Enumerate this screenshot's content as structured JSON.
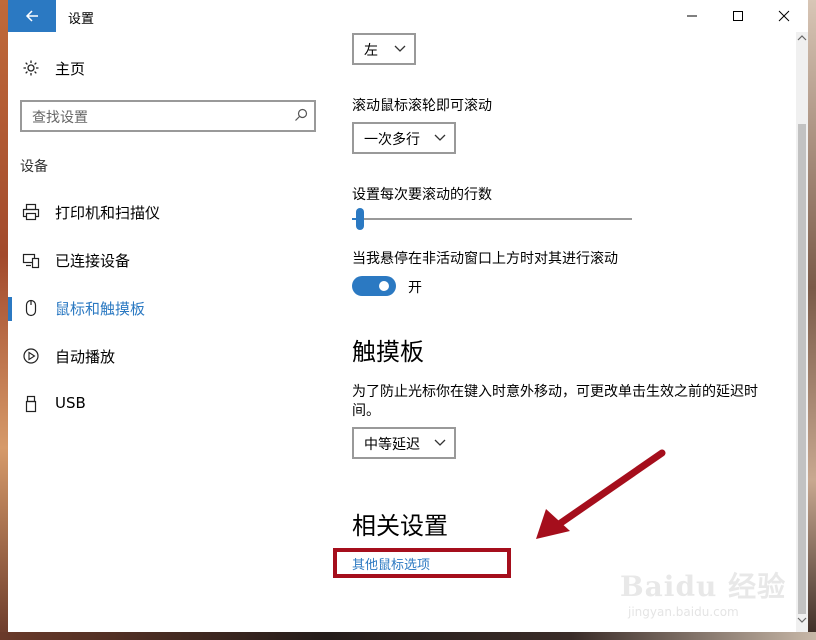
{
  "window": {
    "title": "设置",
    "back_icon": "back-arrow-icon",
    "accent_color": "#2b79c2"
  },
  "sidebar": {
    "home_label": "主页",
    "search_placeholder": "查找设置",
    "section_title": "设备",
    "items": [
      {
        "label": "打印机和扫描仪",
        "icon": "printer-icon",
        "active": false
      },
      {
        "label": "已连接设备",
        "icon": "devices-icon",
        "active": false
      },
      {
        "label": "鼠标和触摸板",
        "icon": "mouse-icon",
        "active": true
      },
      {
        "label": "自动播放",
        "icon": "autoplay-icon",
        "active": false
      },
      {
        "label": "USB",
        "icon": "usb-icon",
        "active": false
      }
    ]
  },
  "mouse": {
    "primary_button_value": "左",
    "wheel_label": "滚动鼠标滚轮即可滚动",
    "wheel_value": "一次多行",
    "lines_label": "设置每次要滚动的行数",
    "lines_slider_fraction": 0.03,
    "inactive_scroll_label": "当我悬停在非活动窗口上方时对其进行滚动",
    "inactive_scroll_on": true,
    "inactive_scroll_state": "开"
  },
  "touchpad": {
    "heading": "触摸板",
    "description": "为了防止光标你在键入时意外移动，可更改单击生效之前的延迟时间。",
    "delay_value": "中等延迟"
  },
  "related": {
    "heading": "相关设置",
    "link_more_mouse": "其他鼠标选项"
  },
  "annotation": {
    "color": "#a50e1c"
  },
  "watermark": {
    "brand": "Baidu 经验",
    "url": "jingyan.baidu.com"
  }
}
